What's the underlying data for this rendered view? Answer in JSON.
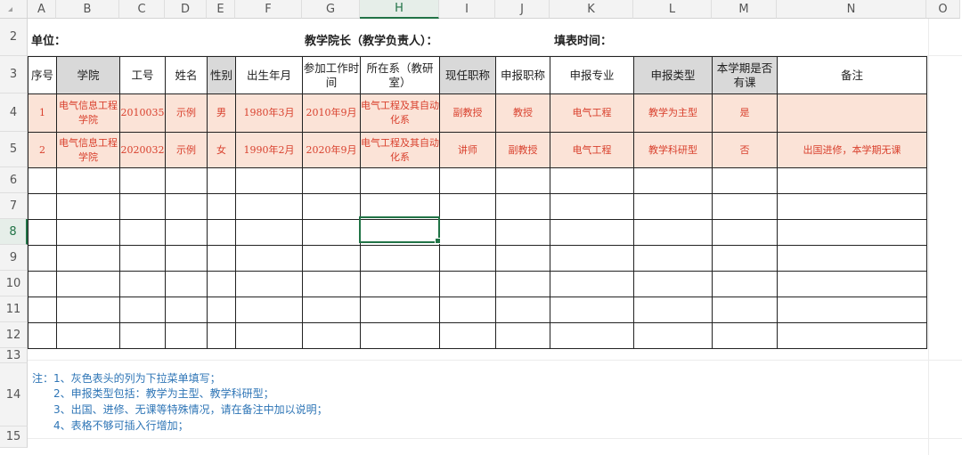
{
  "columns": [
    "A",
    "B",
    "C",
    "D",
    "E",
    "F",
    "G",
    "H",
    "I",
    "J",
    "K",
    "L",
    "M",
    "N",
    "O"
  ],
  "rows": [
    "2",
    "3",
    "4",
    "5",
    "6",
    "7",
    "8",
    "9",
    "10",
    "11",
    "12",
    "13",
    "14",
    "15"
  ],
  "active_cell": {
    "column": "H",
    "row": "8"
  },
  "title_row": {
    "unit_label": "单位：",
    "dean_label": "教学院长（教学负责人）：",
    "date_label": "填表时间："
  },
  "table": {
    "headers": [
      "序号",
      "学院",
      "工号",
      "姓名",
      "性别",
      "出生年月",
      "参加工作时间",
      "所在系（教研室）",
      "现任职称",
      "申报职称",
      "申报专业",
      "申报类型",
      "本学期是否有课",
      "备注"
    ],
    "dropdown_header_columns": [
      "学院",
      "性别",
      "现任职称",
      "申报类型",
      "本学期是否有课"
    ],
    "rows": [
      [
        "1",
        "电气信息工程学院",
        "2010035",
        "示例",
        "男",
        "1980年3月",
        "2010年9月",
        "电气工程及其自动化系",
        "副教授",
        "教授",
        "电气工程",
        "教学为主型",
        "是",
        ""
      ],
      [
        "2",
        "电气信息工程学院",
        "2020032",
        "示例",
        "女",
        "1990年2月",
        "2020年9月",
        "电气工程及其自动化系",
        "讲师",
        "副教授",
        "电气工程",
        "教学科研型",
        "否",
        "出国进修，本学期无课"
      ]
    ],
    "empty_rows": 7
  },
  "notes": [
    "注：1、灰色表头的列为下拉菜单填写；",
    "2、申报类型包括：教学为主型、教学科研型；",
    "3、出国、进修、无课等特殊情况，请在备注中加以说明；",
    "4、表格不够可插入行增加；"
  ],
  "colors": {
    "example_fill": "#fbe3d7",
    "example_text": "#d9412e",
    "header_gray": "#d9d9d9",
    "note_text": "#2e75b6",
    "selection": "#217346"
  }
}
